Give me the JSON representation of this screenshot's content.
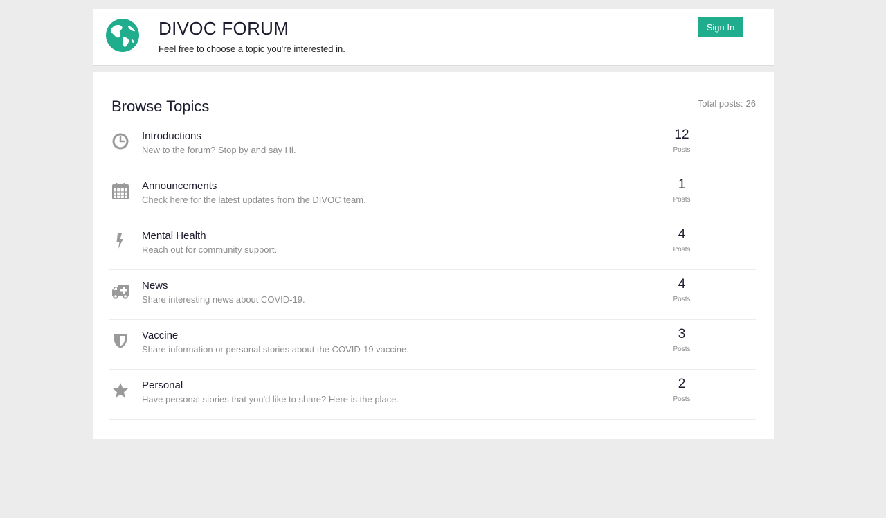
{
  "header": {
    "title": "DIVOC FORUM",
    "tagline": "Feel free to choose a topic you're interested in.",
    "signin_label": "Sign In",
    "logo_icon": "globe-icon",
    "accent_color": "#1fad8e"
  },
  "main": {
    "title": "Browse Topics",
    "total_label": "Total posts:",
    "total_value": "26",
    "count_label": "Posts",
    "topics": [
      {
        "icon": "clock-icon",
        "title": "Introductions",
        "description": "New to the forum? Stop by and say Hi.",
        "count": "12"
      },
      {
        "icon": "calendar-icon",
        "title": "Announcements",
        "description": "Check here for the latest updates from the DIVOC team.",
        "count": "1"
      },
      {
        "icon": "lightning-icon",
        "title": "Mental Health",
        "description": "Reach out for community support.",
        "count": "4"
      },
      {
        "icon": "ambulance-icon",
        "title": "News",
        "description": "Share interesting news about COVID-19.",
        "count": "4"
      },
      {
        "icon": "shield-icon",
        "title": "Vaccine",
        "description": "Share information or personal stories about the COVID-19 vaccine.",
        "count": "3"
      },
      {
        "icon": "star-icon",
        "title": "Personal",
        "description": "Have personal stories that you'd like to share? Here is the place.",
        "count": "2"
      }
    ]
  }
}
